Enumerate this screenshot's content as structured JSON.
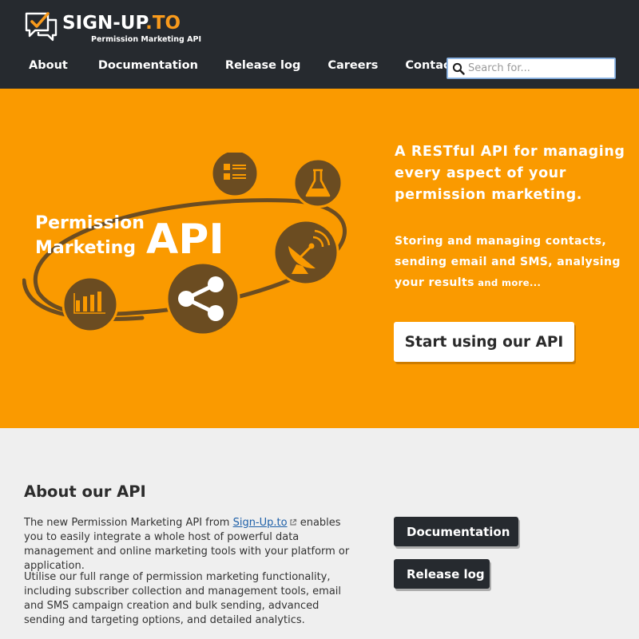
{
  "brand": {
    "name_main": "SIGN-UP",
    "name_accent": ".TO",
    "tagline": "Permission Marketing API",
    "accent_color": "#f89a1c",
    "header_bg": "#262a2f",
    "hero_bg": "#fa9a00",
    "icon_brown": "#6b4c21"
  },
  "nav": {
    "items": [
      {
        "label": "About"
      },
      {
        "label": "Documentation"
      },
      {
        "label": "Release log"
      },
      {
        "label": "Careers"
      },
      {
        "label": "Contact"
      }
    ]
  },
  "search": {
    "placeholder": "Search for...",
    "value": "",
    "icon": "search-icon"
  },
  "hero": {
    "graphic_line1": "Permission",
    "graphic_line2": "Marketing",
    "graphic_api": "API",
    "graphic_icons": [
      "bar-chart-icon",
      "share-icon",
      "satellite-dish-icon",
      "flask-icon",
      "contacts-list-icon"
    ],
    "headline": "A RESTful API for managing every aspect of your permission marketing.",
    "sub_main": "Storing and managing contacts, sending email and SMS, analysing your results",
    "sub_small": " and more...",
    "cta_label": "Start using our API"
  },
  "about": {
    "title": "About our API",
    "p1_before": "The new Permission Marketing API from ",
    "p1_link": "Sign-Up.to",
    "p1_after": " enables you to easily integrate a whole host of powerful data management and online marketing tools with your platform or application.",
    "p2": "Utilise our full range of permission marketing functionality, including subscriber collection and management tools, email and SMS campaign creation and bulk sending, advanced sending and targeting options, and detailed analytics.",
    "btn_docs": "Documentation",
    "btn_release": "Release log"
  }
}
